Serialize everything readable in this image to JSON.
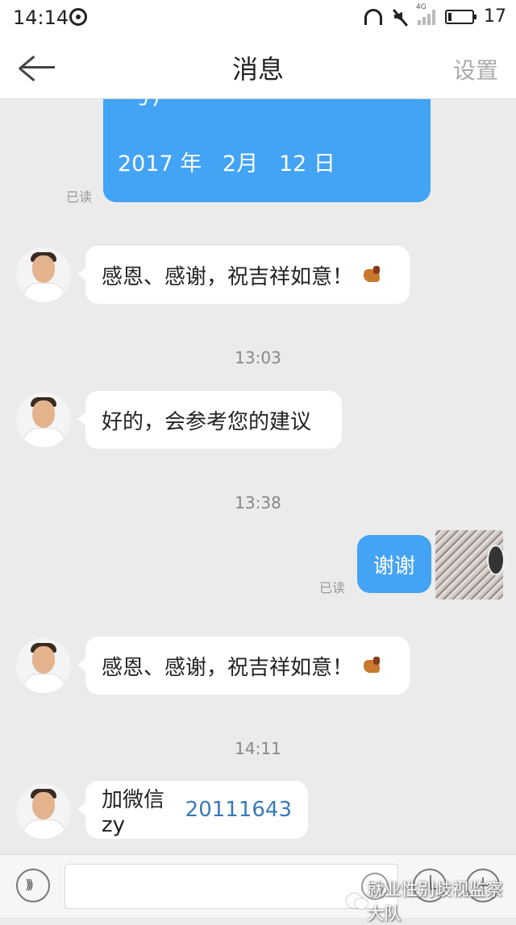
{
  "status_bar": {
    "time": "14:14",
    "network_label": "4G",
    "battery_text": "17"
  },
  "header": {
    "title": "消息",
    "settings_label": "设置"
  },
  "messages": [
    {
      "type": "sent_card",
      "partial_text": "号)",
      "date_text": "2017 年   2月   12 日",
      "read_label": "已读"
    },
    {
      "type": "received",
      "text": "感恩、感谢，祝吉祥如意！",
      "emoji": "horse-emoji"
    },
    {
      "type": "timestamp",
      "text": "13:03"
    },
    {
      "type": "received",
      "text": "好的，会参考您的建议"
    },
    {
      "type": "timestamp",
      "text": "13:38"
    },
    {
      "type": "sent",
      "text": "谢谢",
      "read_label": "已读"
    },
    {
      "type": "received",
      "text": "感恩、感谢，祝吉祥如意！",
      "emoji": "horse-emoji"
    },
    {
      "type": "timestamp",
      "text": "14:11"
    },
    {
      "type": "received",
      "text_prefix": "加微信zy",
      "text_id": "20111643"
    }
  ],
  "input": {
    "placeholder": ""
  },
  "watermark": {
    "text": "就业性别歧视监察大队"
  },
  "colors": {
    "sent_bubble": "#43a3f5",
    "received_bubble": "#ffffff",
    "background": "#ebebeb",
    "link": "#3b78b5"
  }
}
